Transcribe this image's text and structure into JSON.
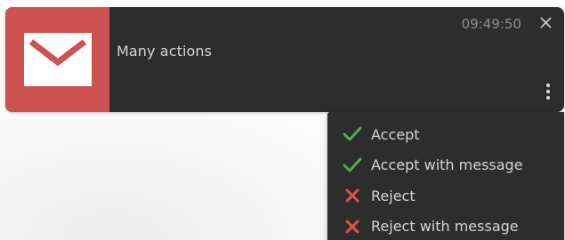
{
  "notification": {
    "icon": "envelope-icon",
    "message": "Many actions",
    "time": "09:49:50",
    "close_icon": "close-icon",
    "more_icon": "more-vertical-icon"
  },
  "menu": {
    "items": [
      {
        "label": "Accept",
        "icon": "check-icon"
      },
      {
        "label": "Accept with message",
        "icon": "check-icon"
      },
      {
        "label": "Reject",
        "icon": "cross-icon"
      },
      {
        "label": "Reject with message",
        "icon": "cross-icon"
      }
    ]
  },
  "colors": {
    "panel_background": "#2d2d2d",
    "icon_panel": "#cd5350",
    "accept_green": "#4caf50",
    "reject_red": "#e0544f",
    "text": "#d4d4d4",
    "time_text": "#8f8f8f"
  }
}
